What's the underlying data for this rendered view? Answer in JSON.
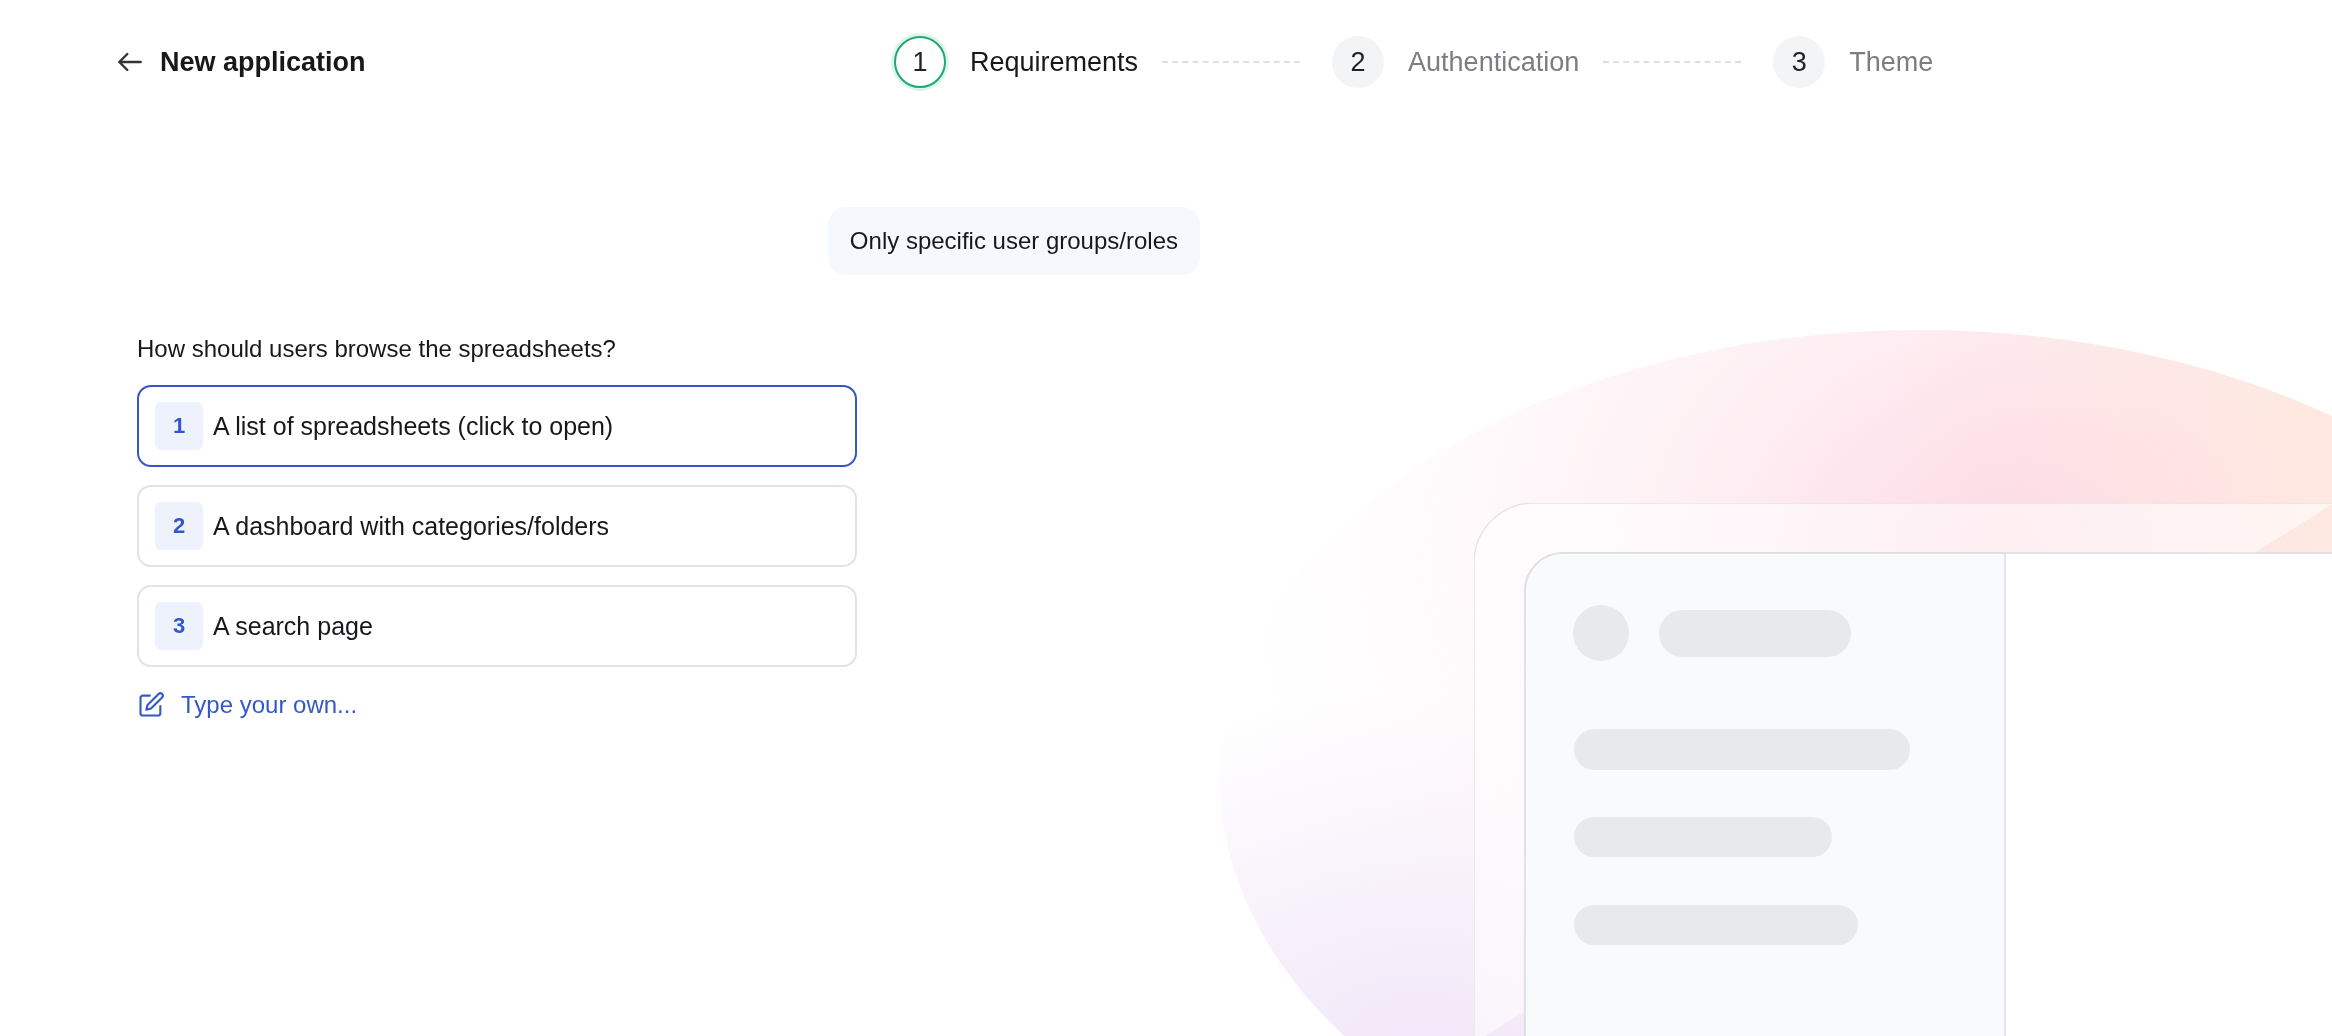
{
  "header": {
    "title": "New application"
  },
  "steps": [
    {
      "number": "1",
      "label": "Requirements",
      "selected": true
    },
    {
      "number": "2",
      "label": "Authentication",
      "selected": false
    },
    {
      "number": "3",
      "label": "Theme",
      "selected": false
    }
  ],
  "chat": {
    "user_message": "Only specific user groups/roles",
    "question": "How should users browse the spreadsheets?"
  },
  "options": [
    {
      "number": "1",
      "label": "A list of spreadsheets (click to open)",
      "selected": true
    },
    {
      "number": "2",
      "label": "A dashboard with categories/folders",
      "selected": false
    },
    {
      "number": "3",
      "label": "A search page",
      "selected": false
    }
  ],
  "custom_answer": {
    "label": "Type your own..."
  }
}
